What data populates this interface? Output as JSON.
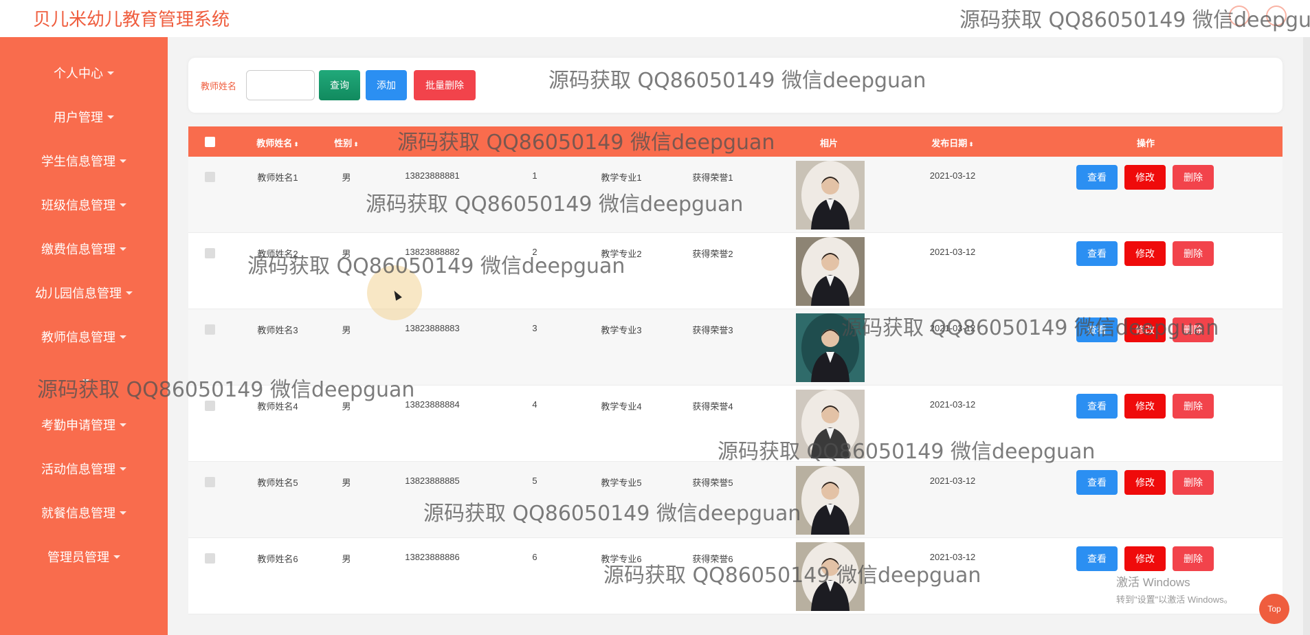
{
  "header": {
    "app_title": "贝儿米幼儿教育管理系统"
  },
  "sidebar": {
    "items": [
      {
        "label": "个人中心"
      },
      {
        "label": "用户管理"
      },
      {
        "label": "学生信息管理"
      },
      {
        "label": "班级信息管理"
      },
      {
        "label": "缴费信息管理"
      },
      {
        "label": "幼儿园信息管理"
      },
      {
        "label": "教师信息管理"
      },
      {
        "label": ""
      },
      {
        "label": "考勤申请管理"
      },
      {
        "label": "活动信息管理"
      },
      {
        "label": "就餐信息管理"
      },
      {
        "label": "管理员管理"
      }
    ]
  },
  "search": {
    "label": "教师姓名",
    "value": "",
    "query_label": "查询",
    "add_label": "添加",
    "batch_delete_label": "批量删除"
  },
  "table": {
    "headers": {
      "name": "教师姓名",
      "gender": "性别",
      "photo": "相片",
      "date": "发布日期",
      "actions": "操作"
    },
    "rows": [
      {
        "name": "教师姓名1",
        "gender": "男",
        "phone": "13823888881",
        "years": "1",
        "major": "教学专业1",
        "honor": "获得荣誉1",
        "date": "2021-03-12"
      },
      {
        "name": "教师姓名2",
        "gender": "男",
        "phone": "13823888882",
        "years": "2",
        "major": "教学专业2",
        "honor": "获得荣誉2",
        "date": "2021-03-12"
      },
      {
        "name": "教师姓名3",
        "gender": "男",
        "phone": "13823888883",
        "years": "3",
        "major": "教学专业3",
        "honor": "获得荣誉3",
        "date": "2021-03-12"
      },
      {
        "name": "教师姓名4",
        "gender": "男",
        "phone": "13823888884",
        "years": "4",
        "major": "教学专业4",
        "honor": "获得荣誉4",
        "date": "2021-03-12"
      },
      {
        "name": "教师姓名5",
        "gender": "男",
        "phone": "13823888885",
        "years": "5",
        "major": "教学专业5",
        "honor": "获得荣誉5",
        "date": "2021-03-12"
      },
      {
        "name": "教师姓名6",
        "gender": "男",
        "phone": "13823888886",
        "years": "6",
        "major": "教学专业6",
        "honor": "获得荣誉6",
        "date": "2021-03-12"
      }
    ],
    "actions": {
      "view": "查看",
      "edit": "修改",
      "delete": "删除"
    }
  },
  "watermark": {
    "text": "源码获取 QQ86050149 微信deepguan",
    "text_clipped": "源码获取 QQ86050149 微信deepgua"
  },
  "os": {
    "activate_title": "激活 Windows",
    "activate_hint": "转到\"设置\"以激活 Windows。"
  },
  "scroll_top_label": "Top",
  "colors": {
    "brand": "#f96c4d",
    "title": "#ef5d3e",
    "view": "#2b8ff2",
    "edit": "#ef0b0b",
    "delete": "#f2434b",
    "query": "#118a5e"
  }
}
